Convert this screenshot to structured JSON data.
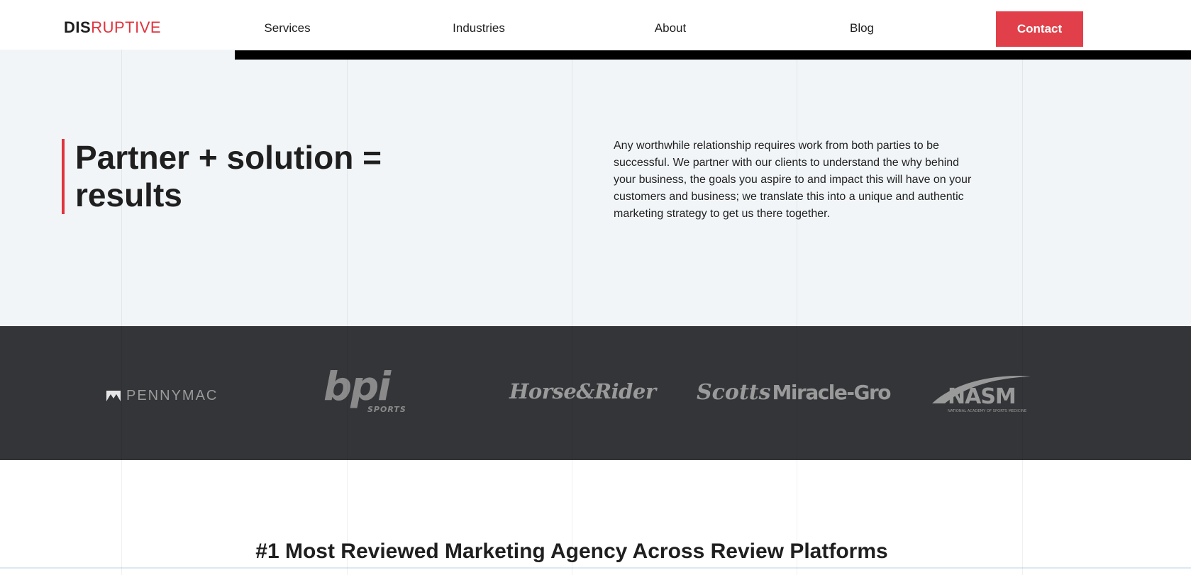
{
  "header": {
    "logo": {
      "part1": "DIS",
      "part2": "RUPTIVE"
    },
    "nav": [
      "Services",
      "Industries",
      "About",
      "Blog"
    ],
    "contact_label": "Contact"
  },
  "hero": {
    "heading": "Partner + solution = results",
    "body": "Any worthwhile relationship requires work from both parties to be successful. We partner with our clients to understand the why behind your business, the goals you aspire to and impact this will have on your customers and business; we translate this into a unique and authentic marketing strategy to get us there together."
  },
  "clients": {
    "pennymac": "PENNYMAC",
    "bpi": "bpi",
    "bpi_sub": "SPORTS",
    "horse_rider": "Horse&Rider",
    "scotts_a": "Scotts",
    "scotts_b": "Miracle-Gro",
    "nasm": "NASM",
    "nasm_sub": "NATIONAL ACADEMY OF SPORTS MEDICINE"
  },
  "reviews": {
    "title": "#1 Most Reviewed Marketing Agency Across Review Platforms"
  },
  "colors": {
    "accent": "#e0333d",
    "hero_bg": "#f1f5f8",
    "band_bg": "#333538"
  }
}
